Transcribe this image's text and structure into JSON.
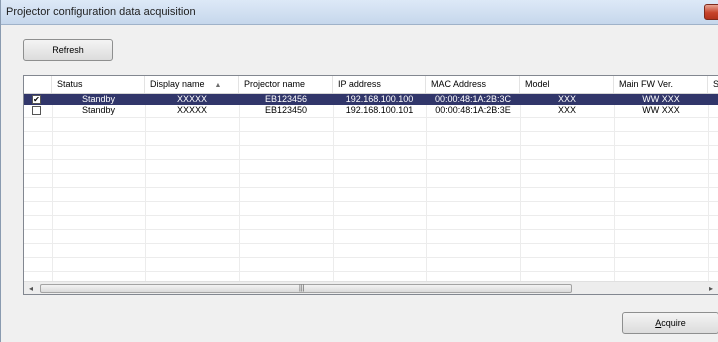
{
  "window": {
    "title": "Projector configuration data acquisition"
  },
  "toolbar": {
    "refresh_access_key": "R",
    "refresh_rest": "efresh"
  },
  "table": {
    "columns": [
      "Status",
      "Display name",
      "Projector name",
      "IP address",
      "MAC Address",
      "Model",
      "Main FW Ver.",
      "Se"
    ],
    "sorted_column": "Display name",
    "sort_direction": "ascending",
    "rows": [
      {
        "checked": true,
        "selected": true,
        "status": "Standby",
        "display_name": "XXXXX",
        "projector_name": "EB123456",
        "ip": "192.168.100.100",
        "mac": "00:00:48:1A:2B:3C",
        "model": "XXX",
        "main_fw": "WW XXX"
      },
      {
        "checked": false,
        "selected": false,
        "status": "Standby",
        "display_name": "XXXXX",
        "projector_name": "EB123450",
        "ip": "192.168.100.101",
        "mac": "00:00:48:1A:2B:3E",
        "model": "XXX",
        "main_fw": "WW XXX"
      }
    ],
    "checkmark": "✔"
  },
  "scrollbar": {
    "left_arrow": "◂",
    "right_arrow": "▸",
    "grip": "|||"
  },
  "footer": {
    "acquire_access_key": "A",
    "acquire_rest": "cquire"
  },
  "colors": {
    "selection": "#31366a",
    "titlebar": "#c6d7ec",
    "close_button": "#c7432b"
  },
  "icons": {
    "sort": "sort-ascending-icon",
    "close": "close-icon",
    "checkbox": "checkbox-icon"
  }
}
